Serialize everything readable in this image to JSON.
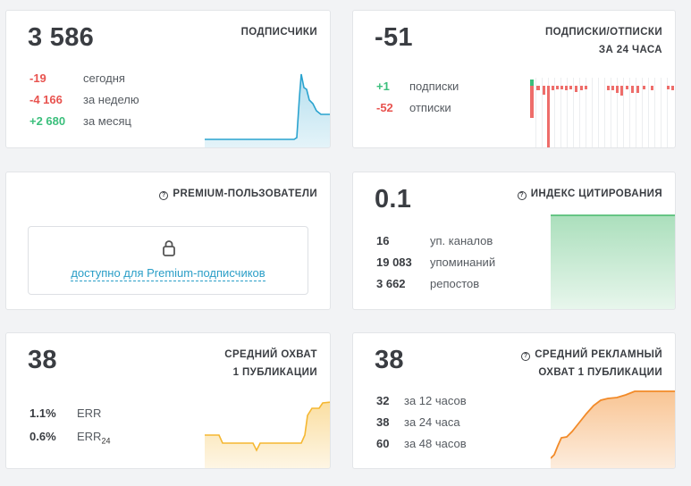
{
  "subscribers": {
    "value": "3 586",
    "title": "ПОДПИСЧИКИ",
    "stats": [
      {
        "value": "-19",
        "label": "сегодня",
        "tone": "red"
      },
      {
        "value": "-4 166",
        "label": "за неделю",
        "tone": "red"
      },
      {
        "value": "+2 680",
        "label": "за месяц",
        "tone": "green"
      }
    ],
    "chart_color": "#2aa3cf"
  },
  "subs_unsubs": {
    "value": "-51",
    "title_line1": "ПОДПИСКИ/ОТПИСКИ",
    "title_line2": "ЗА 24 ЧАСА",
    "stats": [
      {
        "value": "+1",
        "label": "подписки",
        "tone": "green"
      },
      {
        "value": "-52",
        "label": "отписки",
        "tone": "red"
      }
    ],
    "colors": {
      "subs": "#3bbf7c",
      "unsubs": "#ee6d6a"
    }
  },
  "premium": {
    "title": "PREMIUM-ПОЛЬЗОВАТЕЛИ",
    "link_text": "доступно для Premium-подписчиков"
  },
  "citation": {
    "value": "0.1",
    "title": "ИНДЕКС ЦИТИРОВАНИЯ",
    "stats": [
      {
        "value": "16",
        "label": "уп. каналов"
      },
      {
        "value": "19 083",
        "label": "упоминаний"
      },
      {
        "value": "3 662",
        "label": "репостов"
      }
    ],
    "chart_color": "#44b86a"
  },
  "avg_reach": {
    "value": "38",
    "title_line1": "СРЕДНИЙ ОХВАТ",
    "title_line2": "1 ПУБЛИКАЦИИ",
    "stats": [
      {
        "value": "1.1%",
        "label": "ERR",
        "sub": ""
      },
      {
        "value": "0.6%",
        "label": "ERR",
        "sub": "24"
      }
    ],
    "chart_color": "#f5b731"
  },
  "ad_reach": {
    "value": "38",
    "title_line1": "СРЕДНИЙ РЕКЛАМНЫЙ",
    "title_line2": "ОХВАТ 1 ПУБЛИКАЦИИ",
    "stats": [
      {
        "value": "32",
        "label": "за 12 часов"
      },
      {
        "value": "38",
        "label": "за 24 часа"
      },
      {
        "value": "60",
        "label": "за 48 часов"
      }
    ],
    "chart_color": "#f28a28"
  }
}
